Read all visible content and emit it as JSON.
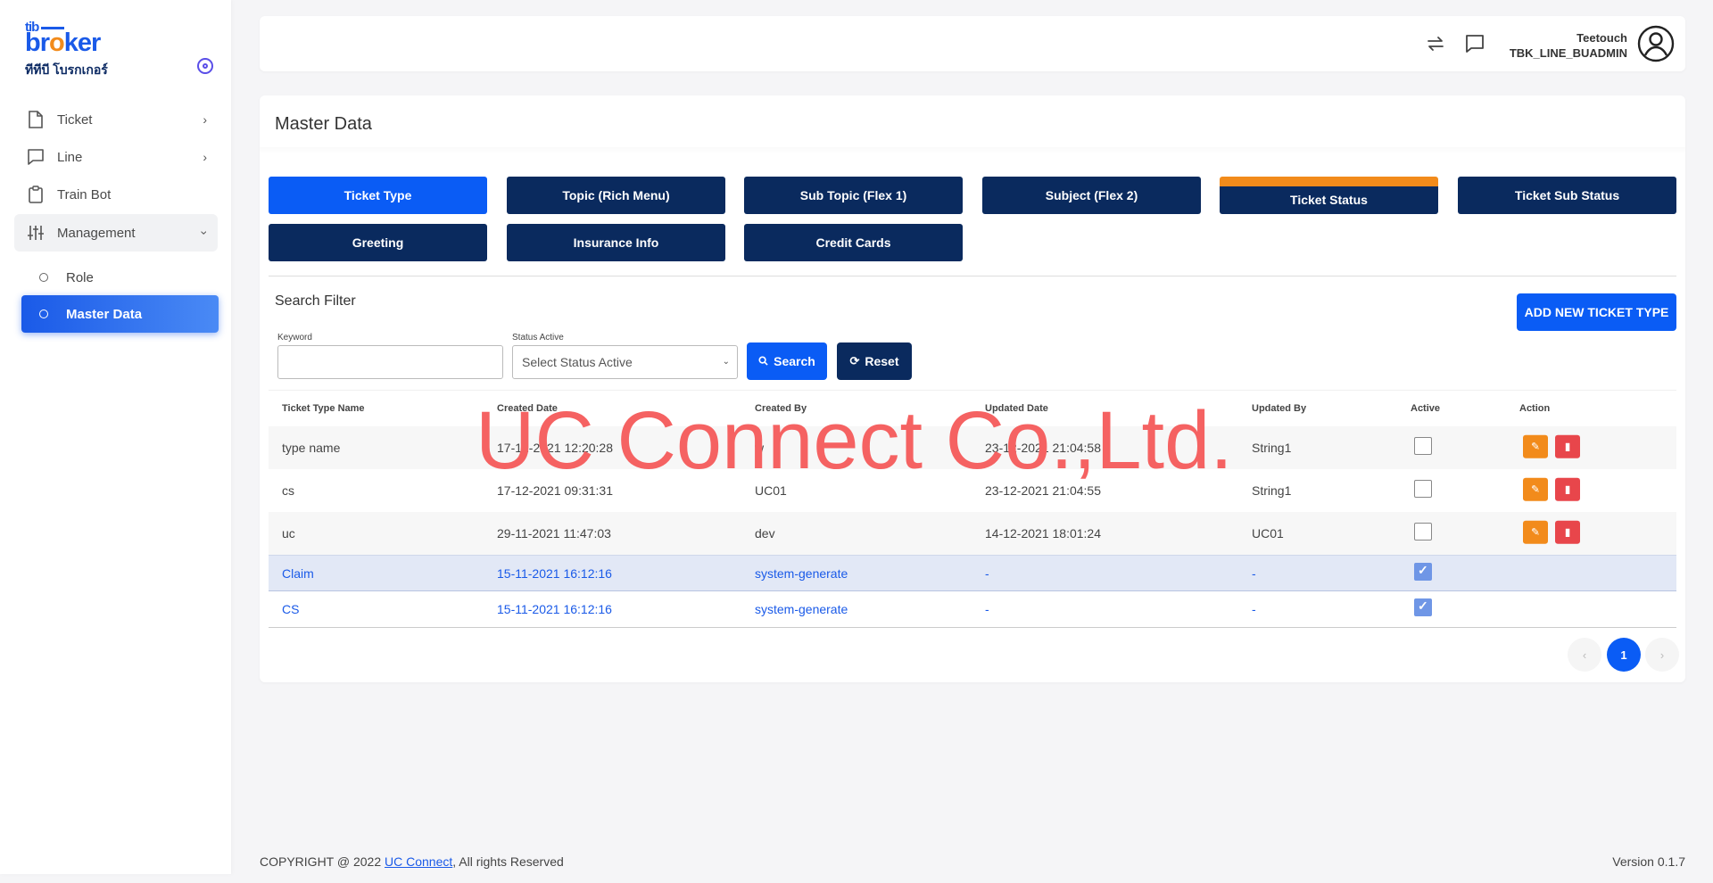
{
  "brand": {
    "logo_top": "tib",
    "logo_main_a": "br",
    "logo_main_o": "o",
    "logo_main_b": "ker",
    "logo_thai": "ทีทีบี โบรกเกอร์"
  },
  "sidebar": {
    "items": [
      {
        "label": "Ticket",
        "icon": "document-icon"
      },
      {
        "label": "Line",
        "icon": "chat-icon"
      },
      {
        "label": "Train Bot",
        "icon": "clipboard-icon"
      },
      {
        "label": "Management",
        "icon": "sliders-icon"
      }
    ],
    "sub_items": [
      {
        "label": "Role"
      },
      {
        "label": "Master Data"
      }
    ]
  },
  "header": {
    "user_name": "Teetouch",
    "user_role": "TBK_LINE_BUADMIN"
  },
  "main": {
    "title": "Master Data",
    "tabs": [
      {
        "label": "Ticket Type"
      },
      {
        "label": "Topic (Rich Menu)"
      },
      {
        "label": "Sub Topic (Flex 1)"
      },
      {
        "label": "Subject (Flex 2)"
      },
      {
        "label": "Ticket Status"
      },
      {
        "label": "Ticket Sub Status"
      },
      {
        "label": "Greeting"
      },
      {
        "label": "Insurance Info"
      },
      {
        "label": "Credit Cards"
      }
    ],
    "filter": {
      "title": "Search Filter",
      "add_label": "ADD NEW TICKET TYPE",
      "keyword_label": "Keyword",
      "keyword_value": "",
      "status_label": "Status Active",
      "status_placeholder": "Select Status Active",
      "search_label": "Search",
      "reset_label": "Reset"
    },
    "table": {
      "columns": [
        "Ticket Type Name",
        "Created Date",
        "Created By",
        "Updated Date",
        "Updated By",
        "Active",
        "Action"
      ],
      "rows": [
        {
          "name": "type name",
          "created_date": "17-12-2021 12:20:28",
          "created_by": "w",
          "updated_date": "23-12-2021 21:04:58",
          "updated_by": "String1",
          "active": false
        },
        {
          "name": "cs",
          "created_date": "17-12-2021 09:31:31",
          "created_by": "UC01",
          "updated_date": "23-12-2021 21:04:55",
          "updated_by": "String1",
          "active": false
        },
        {
          "name": "uc",
          "created_date": "29-11-2021 11:47:03",
          "created_by": "dev",
          "updated_date": "14-12-2021 18:01:24",
          "updated_by": "UC01",
          "active": false
        },
        {
          "name": "Claim",
          "created_date": "15-11-2021 16:12:16",
          "created_by": "system-generate",
          "updated_date": "-",
          "updated_by": "-",
          "active": true
        },
        {
          "name": "CS",
          "created_date": "15-11-2021 16:12:16",
          "created_by": "system-generate",
          "updated_date": "-",
          "updated_by": "-",
          "active": true
        }
      ]
    },
    "pagination": {
      "prev": "‹",
      "current": "1",
      "next": "›"
    }
  },
  "watermark": "UC Connect Co.,Ltd.",
  "footer": {
    "copyright_prefix": "COPYRIGHT @ 2022 ",
    "company_link": "UC Connect",
    "copyright_suffix": ", All rights Reserved",
    "version": "Version 0.1.7"
  },
  "colors": {
    "primary": "#0a5cf5",
    "navy": "#0a2a5e",
    "orange": "#f28b1b",
    "danger": "#e8464b",
    "watermark": "#f56262"
  }
}
